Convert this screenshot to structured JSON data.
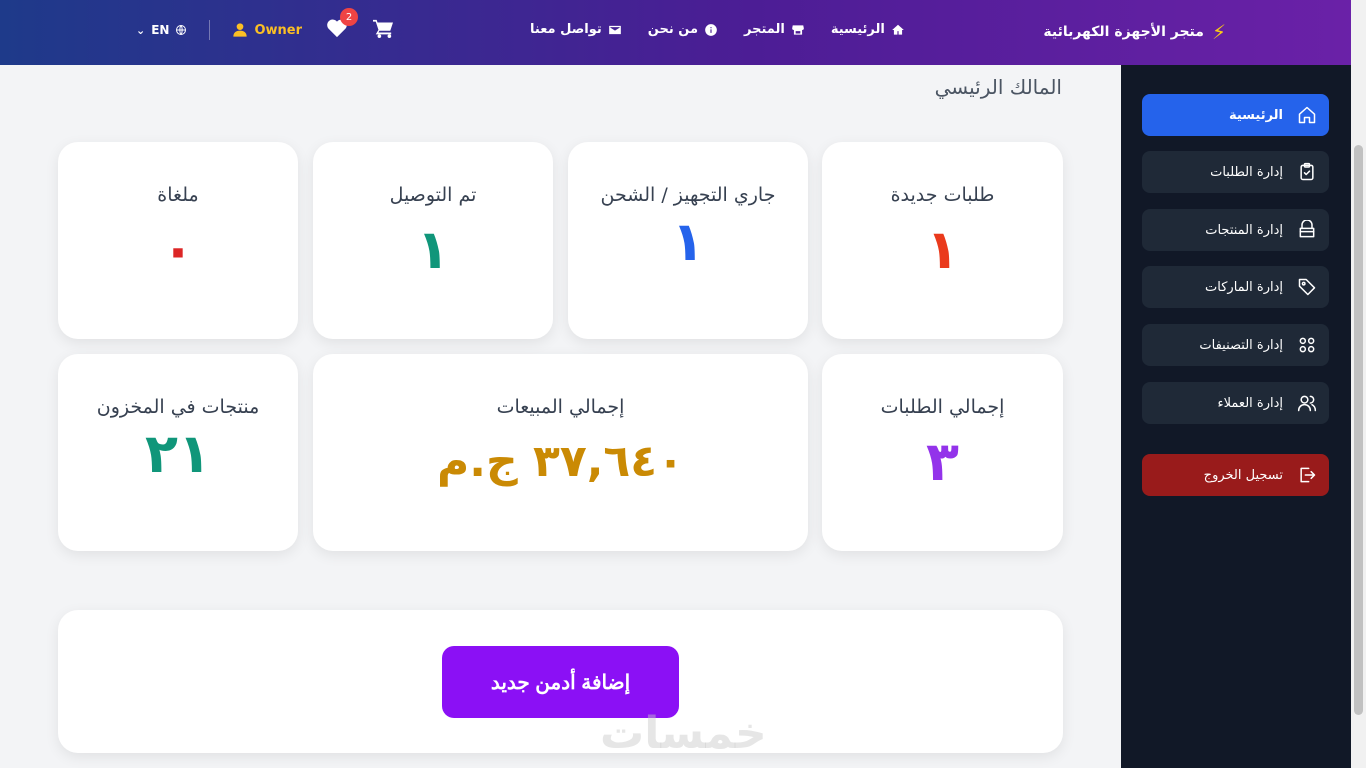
{
  "navbar": {
    "brand": "متجر الأجهزة الكهربائية",
    "links": [
      "الرئيسية",
      "المتجر",
      "من نحن",
      "تواصل معنا"
    ],
    "language": "EN",
    "user": "Owner",
    "wishlist_count": "2"
  },
  "sidebar": {
    "items": [
      {
        "label": "الرئيسية",
        "icon": "home-icon"
      },
      {
        "label": "إدارة الطلبات",
        "icon": "clipboard-check-icon"
      },
      {
        "label": "إدارة المنتجات",
        "icon": "box-icon"
      },
      {
        "label": "إدارة الماركات",
        "icon": "tag-icon"
      },
      {
        "label": "إدارة التصنيفات",
        "icon": "grid-icon"
      },
      {
        "label": "إدارة العملاء",
        "icon": "users-icon"
      }
    ],
    "logout": "تسجيل الخروج"
  },
  "main": {
    "subtitle": "المالك الرئيسي",
    "stats": [
      {
        "title": "طلبات جديدة",
        "value": "١",
        "color": "#ea3a1c"
      },
      {
        "title": "جاري التجهيز / الشحن",
        "value": "١",
        "color": "#2563eb"
      },
      {
        "title": "تم التوصيل",
        "value": "١",
        "color": "#10967a"
      },
      {
        "title": "ملغاة",
        "value": "٠",
        "color": "#dc2626"
      },
      {
        "title": "إجمالي الطلبات",
        "value": "٣",
        "color": "#9333ea"
      },
      {
        "title": "إجمالي المبيعات",
        "value": "٣٧,٦٤٠ ج.م",
        "color": "#ca8a04"
      },
      {
        "title": "منتجات في المخزون",
        "value": "٢١",
        "color": "#10967a"
      }
    ],
    "add_admin": "إضافة أدمن جديد"
  },
  "watermark": "خمسات"
}
